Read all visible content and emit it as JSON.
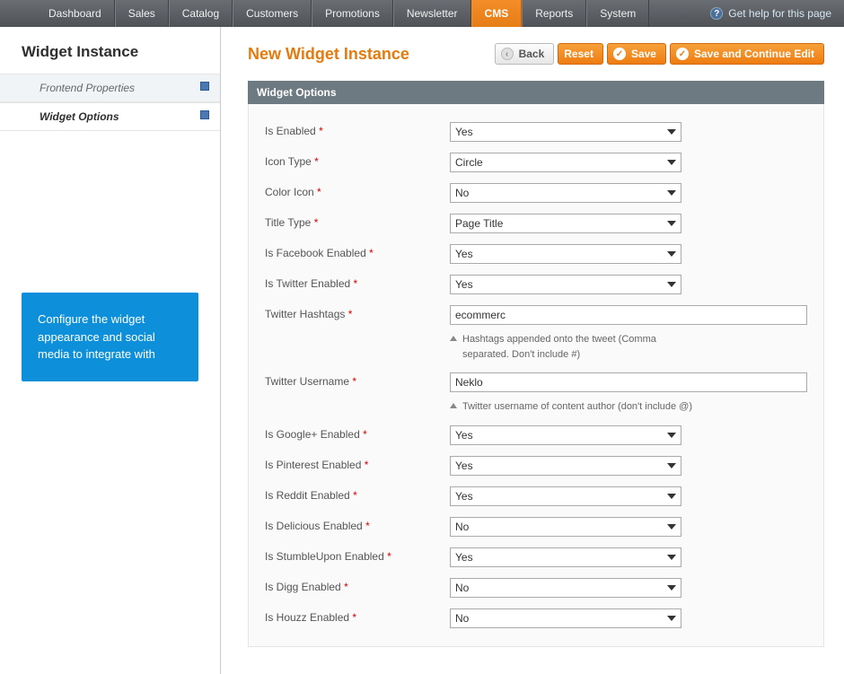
{
  "topnav": {
    "items": [
      "Dashboard",
      "Sales",
      "Catalog",
      "Customers",
      "Promotions",
      "Newsletter",
      "CMS",
      "Reports",
      "System"
    ],
    "active_index": 6,
    "help_label": "Get help for this page"
  },
  "sidebar": {
    "title": "Widget Instance",
    "tabs": [
      {
        "label": "Frontend Properties",
        "active": false
      },
      {
        "label": "Widget Options",
        "active": true
      }
    ],
    "info_box": "Configure the widget appearance and social media to integrate with"
  },
  "header": {
    "title": "New Widget Instance",
    "buttons": {
      "back": "Back",
      "reset": "Reset",
      "save": "Save",
      "save_continue": "Save and Continue Edit"
    }
  },
  "section_title": "Widget Options",
  "fields": {
    "is_enabled": {
      "label": "Is Enabled",
      "value": "Yes"
    },
    "icon_type": {
      "label": "Icon Type",
      "value": "Circle"
    },
    "color_icon": {
      "label": "Color Icon",
      "value": "No"
    },
    "title_type": {
      "label": "Title Type",
      "value": "Page Title"
    },
    "is_facebook": {
      "label": "Is Facebook Enabled",
      "value": "Yes"
    },
    "is_twitter": {
      "label": "Is Twitter Enabled",
      "value": "Yes"
    },
    "twitter_hashtags": {
      "label": "Twitter Hashtags",
      "value": "ecommerc",
      "hint": "Hashtags appended onto the tweet (Comma separated. Don't include #)"
    },
    "twitter_username": {
      "label": "Twitter Username",
      "value": "Neklo",
      "hint": "Twitter username of content author (don't include @)"
    },
    "is_google": {
      "label": "Is Google+ Enabled",
      "value": "Yes"
    },
    "is_pinterest": {
      "label": "Is Pinterest Enabled",
      "value": "Yes"
    },
    "is_reddit": {
      "label": "Is Reddit Enabled",
      "value": "Yes"
    },
    "is_delicious": {
      "label": "Is Delicious Enabled",
      "value": "No"
    },
    "is_stumbleupon": {
      "label": "Is StumbleUpon Enabled",
      "value": "Yes"
    },
    "is_digg": {
      "label": "Is Digg Enabled",
      "value": "No"
    },
    "is_houzz": {
      "label": "Is Houzz Enabled",
      "value": "No"
    }
  }
}
